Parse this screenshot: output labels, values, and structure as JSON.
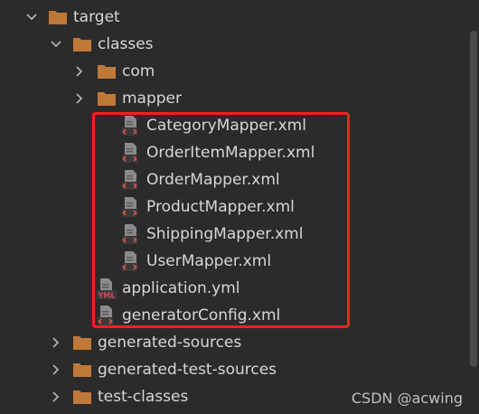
{
  "tree": {
    "items": [
      {
        "label": "target",
        "icon": "folder-icon",
        "expanded": true
      },
      {
        "label": "classes",
        "icon": "folder-icon",
        "expanded": true
      },
      {
        "label": "com",
        "icon": "folder-icon",
        "expanded": false
      },
      {
        "label": "mapper",
        "icon": "folder-icon",
        "expanded": false
      },
      {
        "label": "CategoryMapper.xml",
        "icon": "xml-file-icon"
      },
      {
        "label": "OrderItemMapper.xml",
        "icon": "xml-file-icon"
      },
      {
        "label": "OrderMapper.xml",
        "icon": "xml-file-icon"
      },
      {
        "label": "ProductMapper.xml",
        "icon": "xml-file-icon"
      },
      {
        "label": "ShippingMapper.xml",
        "icon": "xml-file-icon"
      },
      {
        "label": "UserMapper.xml",
        "icon": "xml-file-icon"
      },
      {
        "label": "application.yml",
        "icon": "yml-file-icon"
      },
      {
        "label": "generatorConfig.xml",
        "icon": "xml-file-icon"
      },
      {
        "label": "generated-sources",
        "icon": "folder-icon",
        "expanded": false
      },
      {
        "label": "generated-test-sources",
        "icon": "folder-icon",
        "expanded": false
      },
      {
        "label": "test-classes",
        "icon": "folder-icon",
        "expanded": false
      }
    ]
  },
  "yml_badge": "YML",
  "watermark": "CSDN @acwing",
  "colors": {
    "background": "#2b2b2b",
    "folder": "#c07838",
    "text": "#d6d6d6",
    "highlight": "#ff1f1f",
    "xml_tag": "#e5533d",
    "yml_badge": "#d64a5a"
  }
}
